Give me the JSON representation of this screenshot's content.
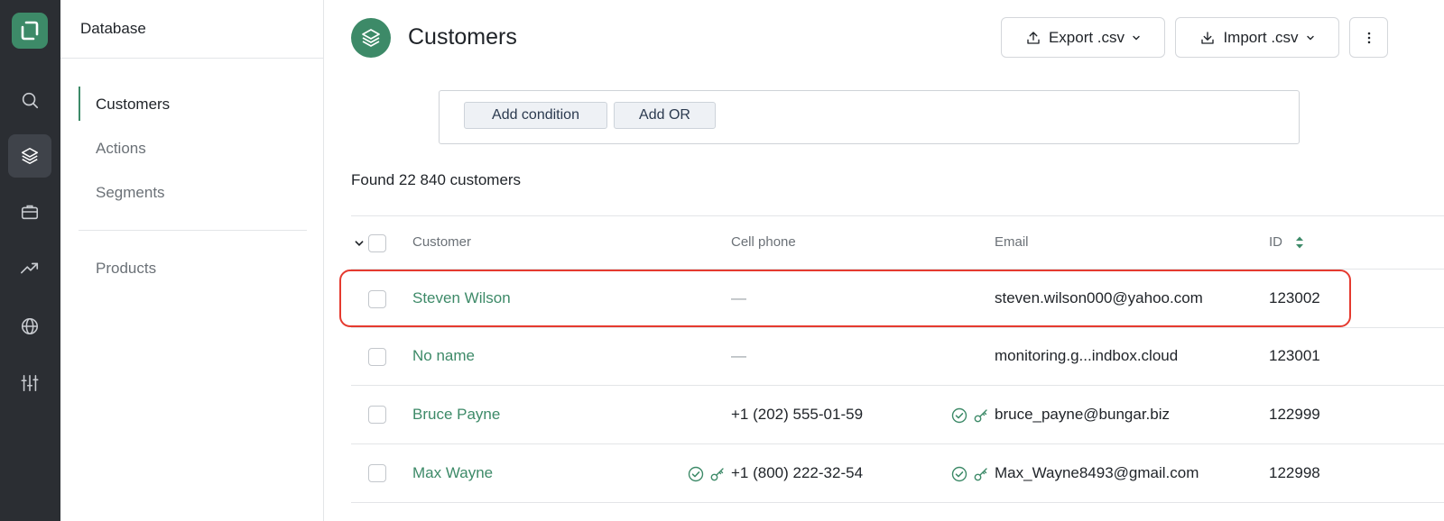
{
  "rail": {
    "items": [
      {
        "icon": "search-icon"
      },
      {
        "icon": "layers-icon",
        "active": true
      },
      {
        "icon": "briefcase-icon"
      },
      {
        "icon": "trending-up-icon"
      },
      {
        "icon": "globe-icon"
      },
      {
        "icon": "sliders-icon"
      }
    ]
  },
  "sidebar": {
    "title": "Database",
    "items": [
      {
        "label": "Customers",
        "active": true
      },
      {
        "label": "Actions"
      },
      {
        "label": "Segments"
      },
      {
        "label": "Products"
      }
    ]
  },
  "header": {
    "title": "Customers",
    "export_label": "Export .csv",
    "import_label": "Import .csv"
  },
  "filter": {
    "add_condition": "Add condition",
    "add_or": "Add OR"
  },
  "found_text": "Found 22 840 customers",
  "table": {
    "columns": [
      "Customer",
      "Cell phone",
      "Email",
      "ID"
    ],
    "rows": [
      {
        "name": "Steven Wilson",
        "phone": "—",
        "email": "steven.wilson000@yahoo.com",
        "id": "123002",
        "phone_verified": false,
        "email_verified": false
      },
      {
        "name": "No name",
        "phone": "—",
        "email": "monitoring.g...indbox.cloud",
        "id": "123001",
        "phone_verified": false,
        "email_verified": false
      },
      {
        "name": "Bruce Payne",
        "phone": "+1 (202) 555-01-59",
        "email": "bruce_payne@bungar.biz",
        "id": "122999",
        "phone_verified": false,
        "email_verified": true
      },
      {
        "name": "Max Wayne",
        "phone": "+1 (800) 222-32-54",
        "email": "Max_Wayne8493@gmail.com",
        "id": "122998",
        "phone_verified": true,
        "email_verified": true
      }
    ]
  },
  "colors": {
    "accent": "#3d8a68",
    "rail_bg": "#2b2e33",
    "highlight": "#e53a2f"
  }
}
